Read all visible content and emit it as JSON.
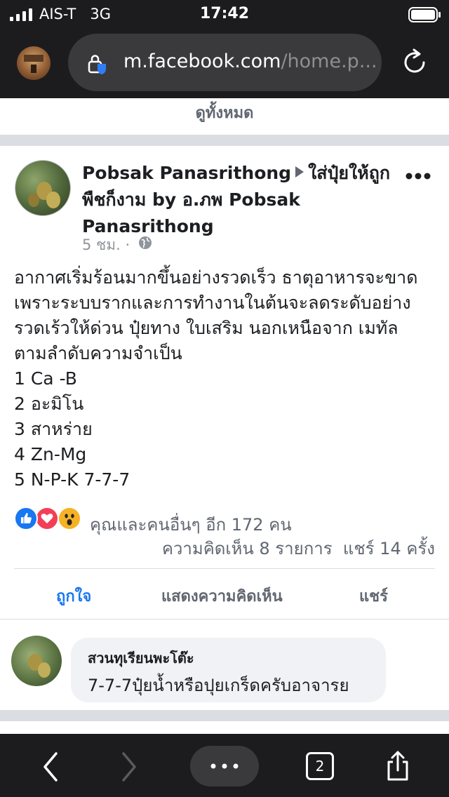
{
  "status_bar": {
    "carrier": "AIS-T",
    "network": "3G",
    "time": "17:42"
  },
  "browser": {
    "url_main": "m.facebook.com",
    "url_dim": "/home.p..."
  },
  "feed": {
    "see_all": "ดูทั้งหมด"
  },
  "post": {
    "author": "Pobsak Panasrithong",
    "group": "ใส่ปุ๋ยให้ถูกพืชก็งาม by อ.ภพ Pobsak Panasrithong",
    "time": "5 ชม. ·",
    "body_lines": [
      "อากาศเริ่มร้อนมากขึ้นอย่างรวดเร็ว ธาตุอาหารจะขาด",
      "เพราะระบบรากและการทำงานในต้นจะลดระดับอย่าง",
      "รวดเร้วให้ด่วน ปุ๋ยทาง ใบเสริม นอกเหนือจาก เมทัล",
      "ตามลำดับความจำเป็น",
      "1 Ca -B",
      "2 อะมิโน",
      "3 สาหร่าย",
      "4 Zn-Mg",
      "5 N-P-K 7-7-7"
    ],
    "reactions_text": "คุณและคนอื่นๆ อีก 172 คน",
    "comments_count": "ความคิดเห็น 8 รายการ",
    "shares_count": "แชร์ 14 ครั้ง",
    "actions": {
      "like": "ถูกใจ",
      "comment": "แสดงความคิดเห็น",
      "share": "แชร์"
    },
    "colors": {
      "like": "#1877f2",
      "love": "#f33e58",
      "wow": "#f7b125"
    }
  },
  "comment": {
    "author": "สวนทุเรียนพะโต๊ะ",
    "text": "7-7-7ปุ๋ยน้ำหรือปุยเกร็ดครับอาจารย"
  },
  "toolbar": {
    "tabs_count": "2"
  },
  "icons": [
    "signal-icon",
    "battery-icon",
    "lock-icon",
    "reload-icon",
    "more-icon",
    "globe-icon",
    "like-reaction-icon",
    "love-reaction-icon",
    "wow-reaction-icon",
    "back-icon",
    "forward-icon",
    "menu-icon",
    "share-icon"
  ]
}
